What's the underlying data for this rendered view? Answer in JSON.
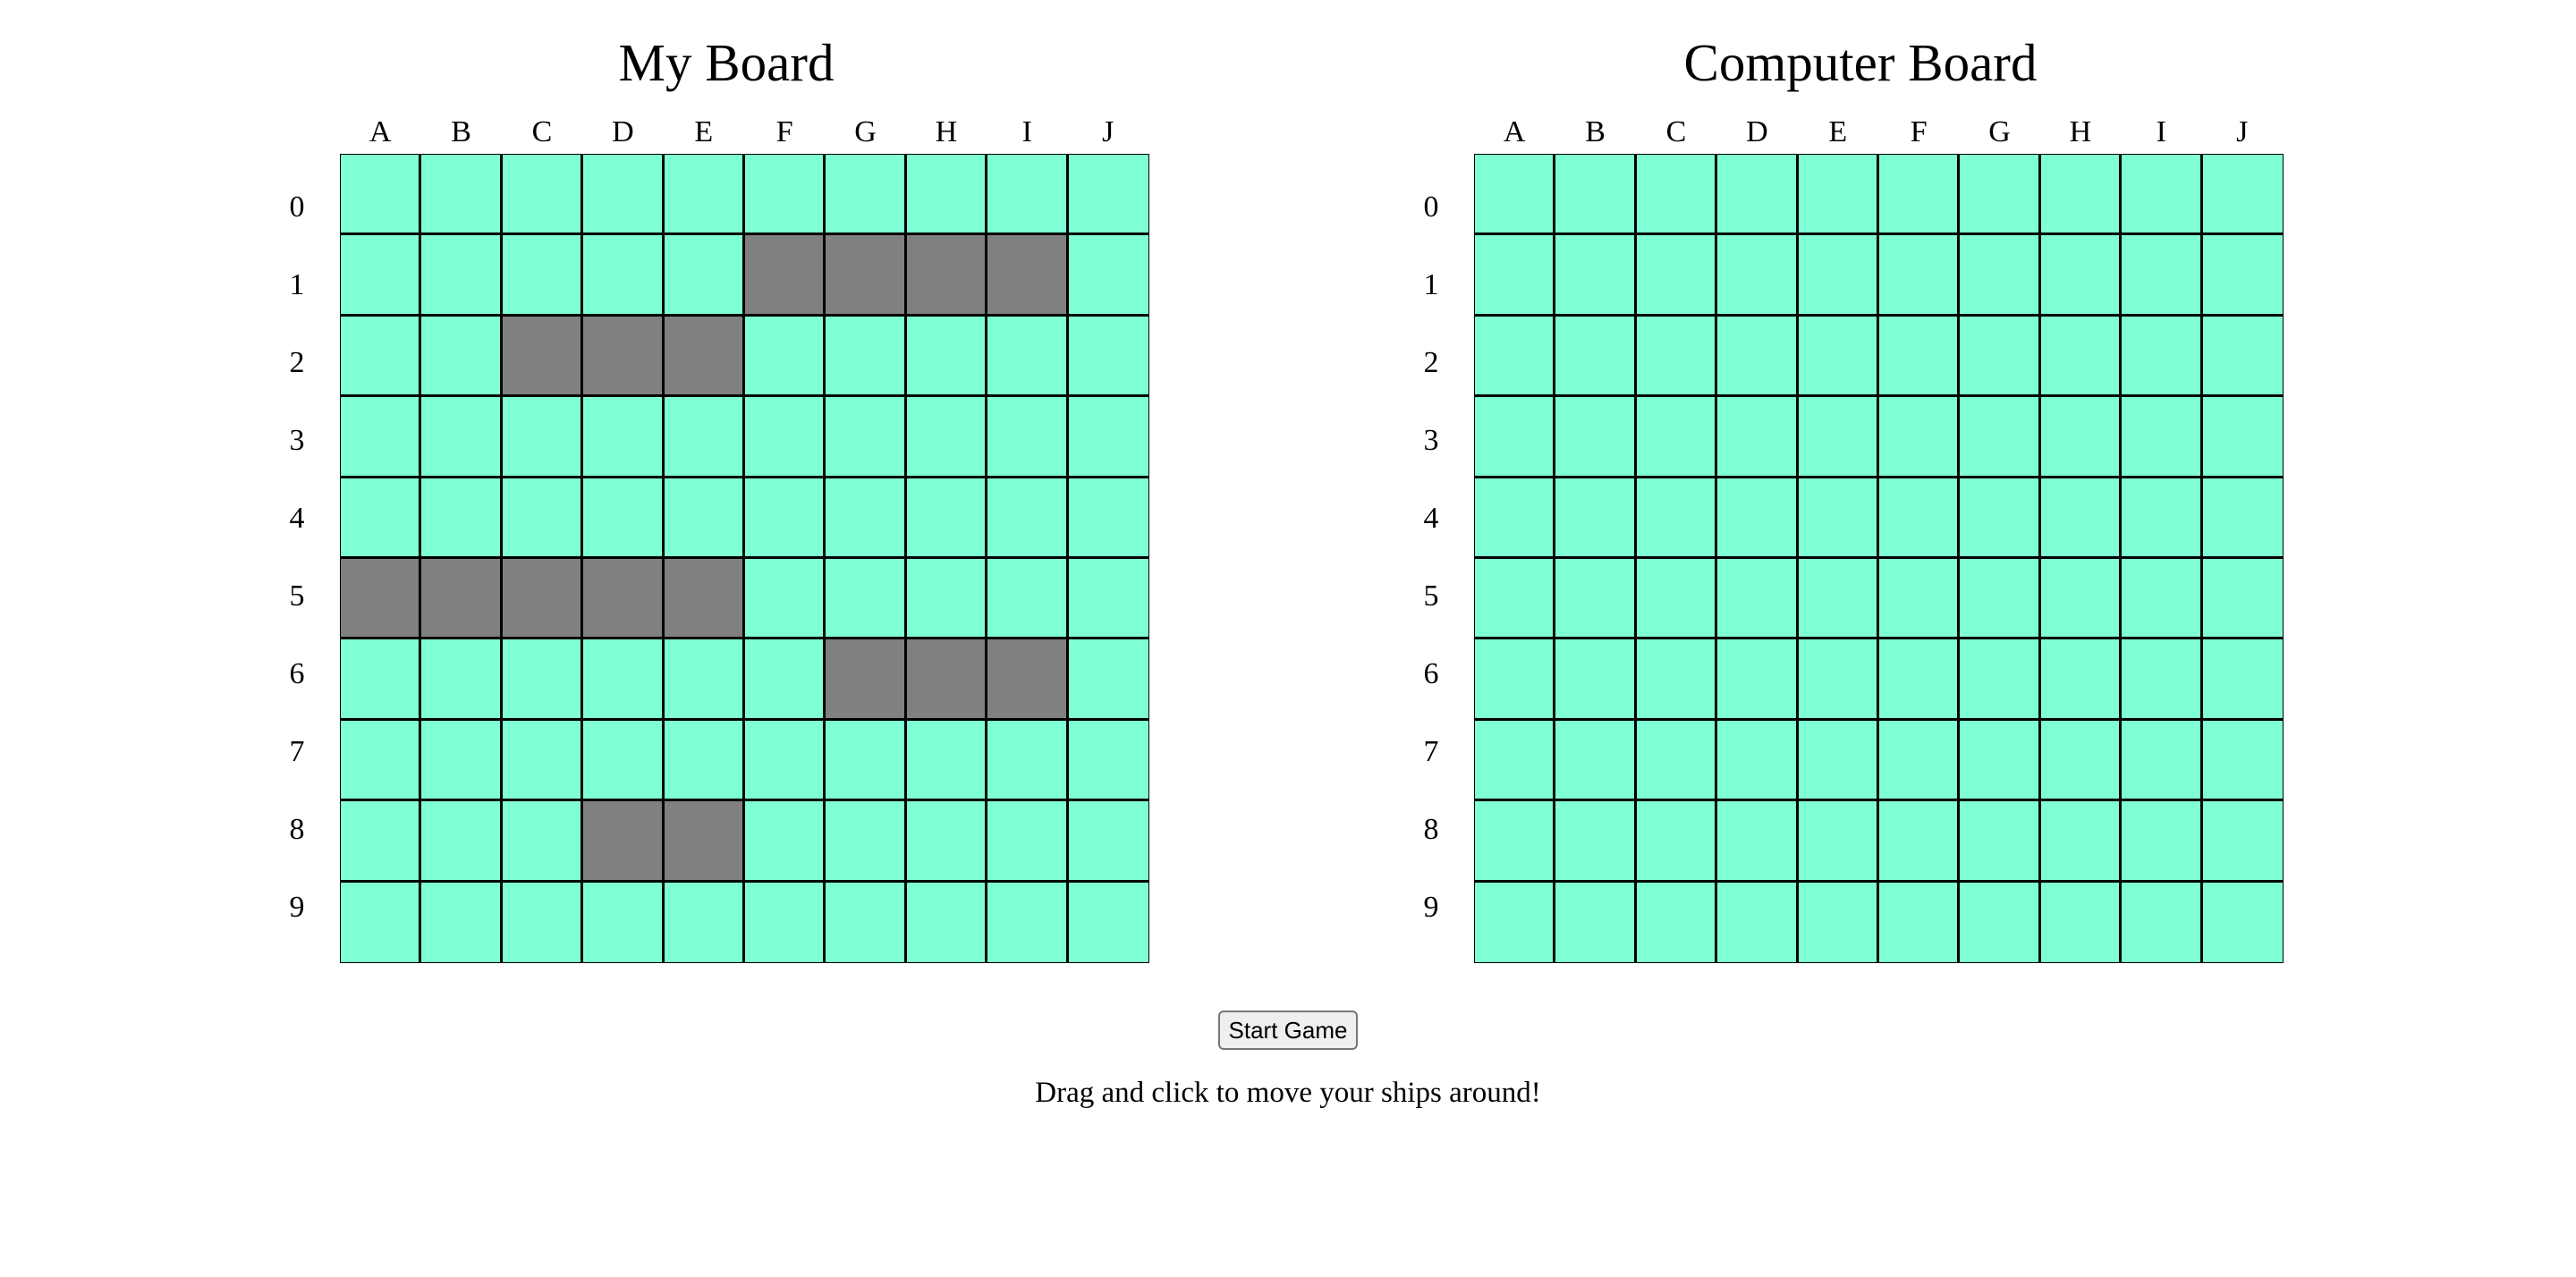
{
  "columns": [
    "A",
    "B",
    "C",
    "D",
    "E",
    "F",
    "G",
    "H",
    "I",
    "J"
  ],
  "rows": [
    "0",
    "1",
    "2",
    "3",
    "4",
    "5",
    "6",
    "7",
    "8",
    "9"
  ],
  "colors": {
    "water": "#7fffd4",
    "ship": "#808080",
    "grid_line": "#000000"
  },
  "my_board": {
    "title": "My Board",
    "ship_cells": [
      "F1",
      "G1",
      "H1",
      "I1",
      "C2",
      "D2",
      "E2",
      "A5",
      "B5",
      "C5",
      "D5",
      "E5",
      "G6",
      "H6",
      "I6",
      "D8",
      "E8"
    ]
  },
  "computer_board": {
    "title": "Computer Board",
    "ship_cells": []
  },
  "controls": {
    "start_label": "Start Game",
    "hint": "Drag and click to move your ships around!"
  }
}
